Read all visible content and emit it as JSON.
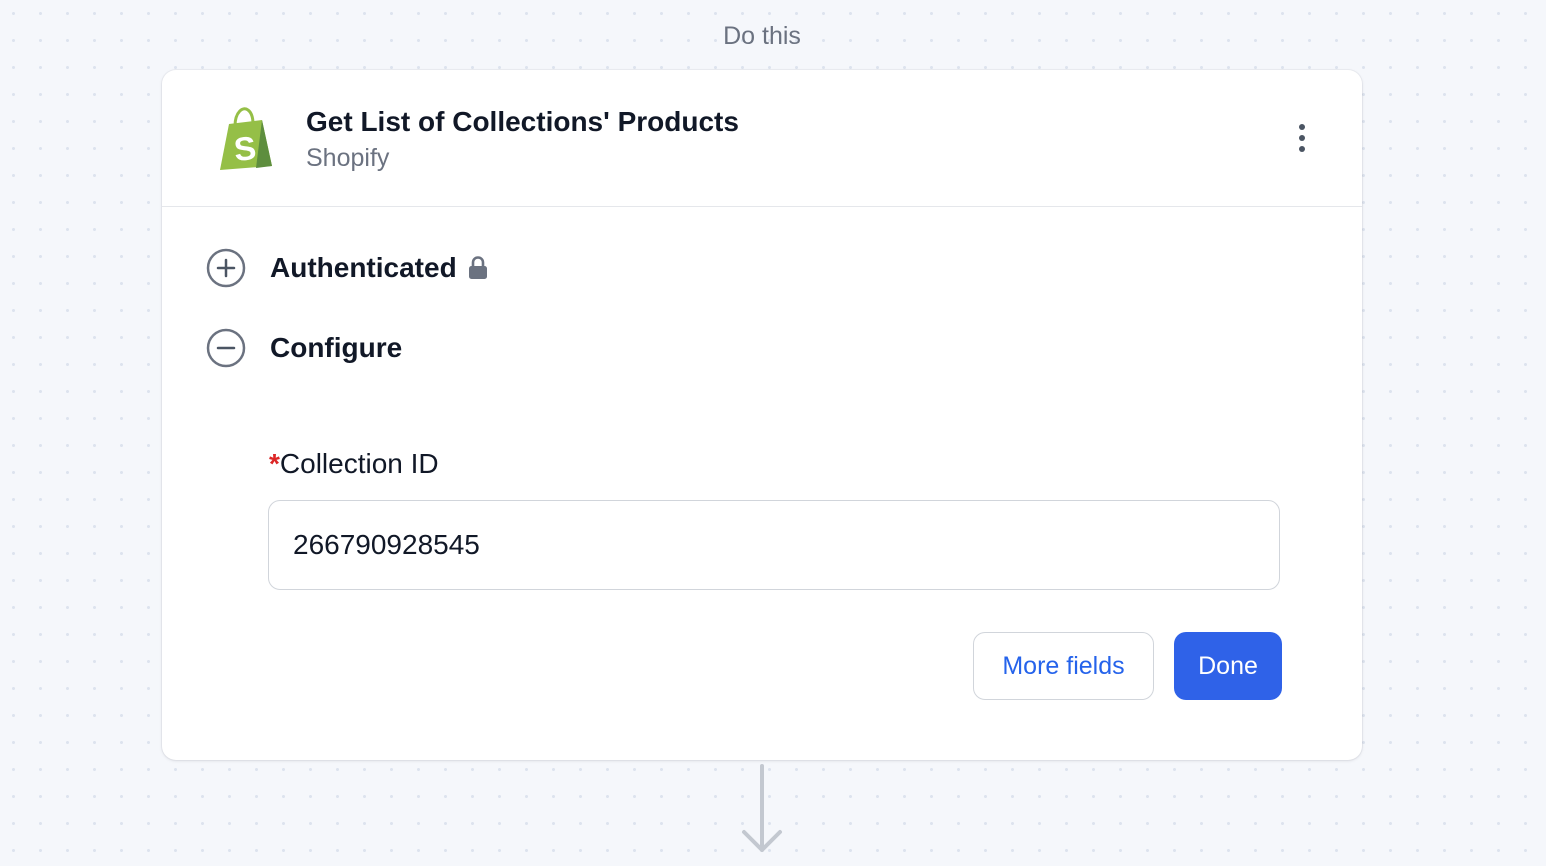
{
  "step_label": "Do this",
  "action": {
    "title": "Get List of Collections' Products",
    "app_name": "Shopify",
    "app_icon": "shopify-bag-icon",
    "menu_icon": "kebab-menu-icon"
  },
  "sections": {
    "authenticated": {
      "title": "Authenticated",
      "state": "collapsed",
      "toggle_icon": "plus-circle-icon",
      "status_icon": "lock-icon"
    },
    "configure": {
      "title": "Configure",
      "state": "expanded",
      "toggle_icon": "minus-circle-icon"
    }
  },
  "fields": {
    "collection_id": {
      "required_mark": "*",
      "label": "Collection ID",
      "value": "266790928545"
    }
  },
  "buttons": {
    "more_fields": "More fields",
    "done": "Done"
  },
  "colors": {
    "primary": "#2f62e8",
    "link": "#2563eb",
    "required": "#dc2626",
    "shopify_green": "#95bf47",
    "canvas_bg": "#f5f7fb"
  }
}
